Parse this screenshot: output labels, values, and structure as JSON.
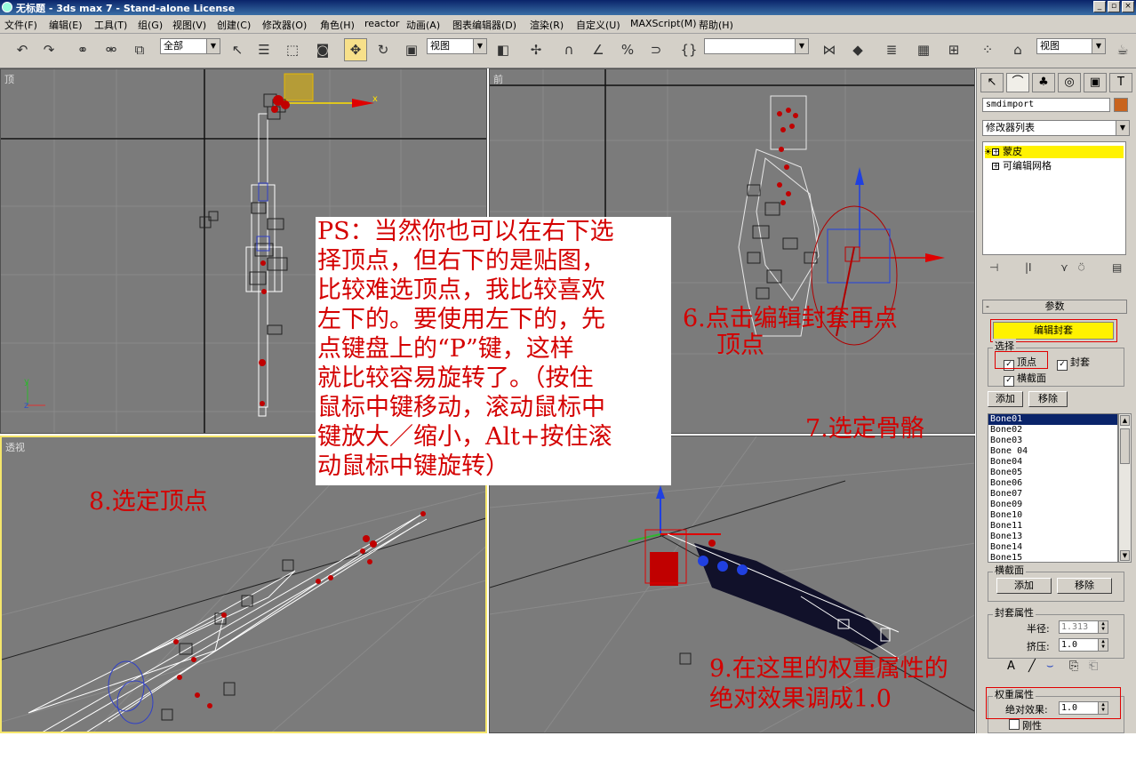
{
  "window": {
    "title": "无标题 - 3ds max 7 - Stand-alone License",
    "buttons": [
      "_",
      "▫",
      "×"
    ]
  },
  "menu": [
    "文件(F)",
    "编辑(E)",
    "工具(T)",
    "组(G)",
    "视图(V)",
    "创建(C)",
    "修改器(O)",
    "角色(H)",
    "reactor",
    "动画(A)",
    "图表编辑器(D)",
    "渲染(R)",
    "自定义(U)",
    "MAXScript(M)",
    "帮助(H)"
  ],
  "toolbar": {
    "selection_filter": "全部",
    "ref_coord": "视图",
    "named_set": "",
    "render_view": "视图"
  },
  "viewports": {
    "top": "顶",
    "front": "前",
    "left_bottom": "透视",
    "axis_x": "x",
    "axis_y": "y",
    "axis_z": "z"
  },
  "command_panel": {
    "object_name": "smdimport",
    "modifier_list": "修改器列表",
    "stack": [
      {
        "label": "蒙皮",
        "selected": true
      },
      {
        "label": "可编辑网格",
        "selected": false
      }
    ],
    "params_title": "参数",
    "edit_envelope": "编辑封套",
    "select_group": "选择",
    "vertex_label": "顶点",
    "envelope_label": "封套",
    "cross_section_label": "横截面",
    "add_label": "添加",
    "remove_label": "移除",
    "bones": [
      "Bone01",
      "Bone02",
      "Bone03",
      "Bone 04",
      "Bone04",
      "Bone05",
      "Bone06",
      "Bone07",
      "Bone09",
      "Bone10",
      "Bone11",
      "Bone13",
      "Bone14",
      "Bone15"
    ],
    "cross_section_group": "横截面",
    "add2_label": "添加",
    "remove2_label": "移除",
    "env_props_group": "封套属性",
    "radius_label": "半径:",
    "radius_value": "1.313",
    "squash_label": "挤压:",
    "squash_value": "1.0",
    "weight_group": "权重属性",
    "abs_effect_label": "绝对效果:",
    "abs_effect_value": "1.0",
    "rigid_label": "刚性"
  },
  "annotations": {
    "ps_lines": [
      "PS：当然你也可以在右下选",
      "择顶点，但右下的是贴图，",
      "比较难选顶点，我比较喜欢",
      "左下的。要使用左下的，先",
      "点键盘上的“P”键，这样",
      "就比较容易旋转了。（按住",
      "鼠标中键移动，滚动鼠标中",
      "键放大／缩小，Alt+按住滚",
      "动鼠标中键旋转）"
    ],
    "step6_line1": "6.点击编辑封套再点",
    "step6_line2": "顶点",
    "step7": "7.选定骨骼",
    "step8": "8.选定顶点",
    "step9_line1": "9.在这里的权重属性的",
    "step9_line2": "绝对效果调成1.0"
  }
}
